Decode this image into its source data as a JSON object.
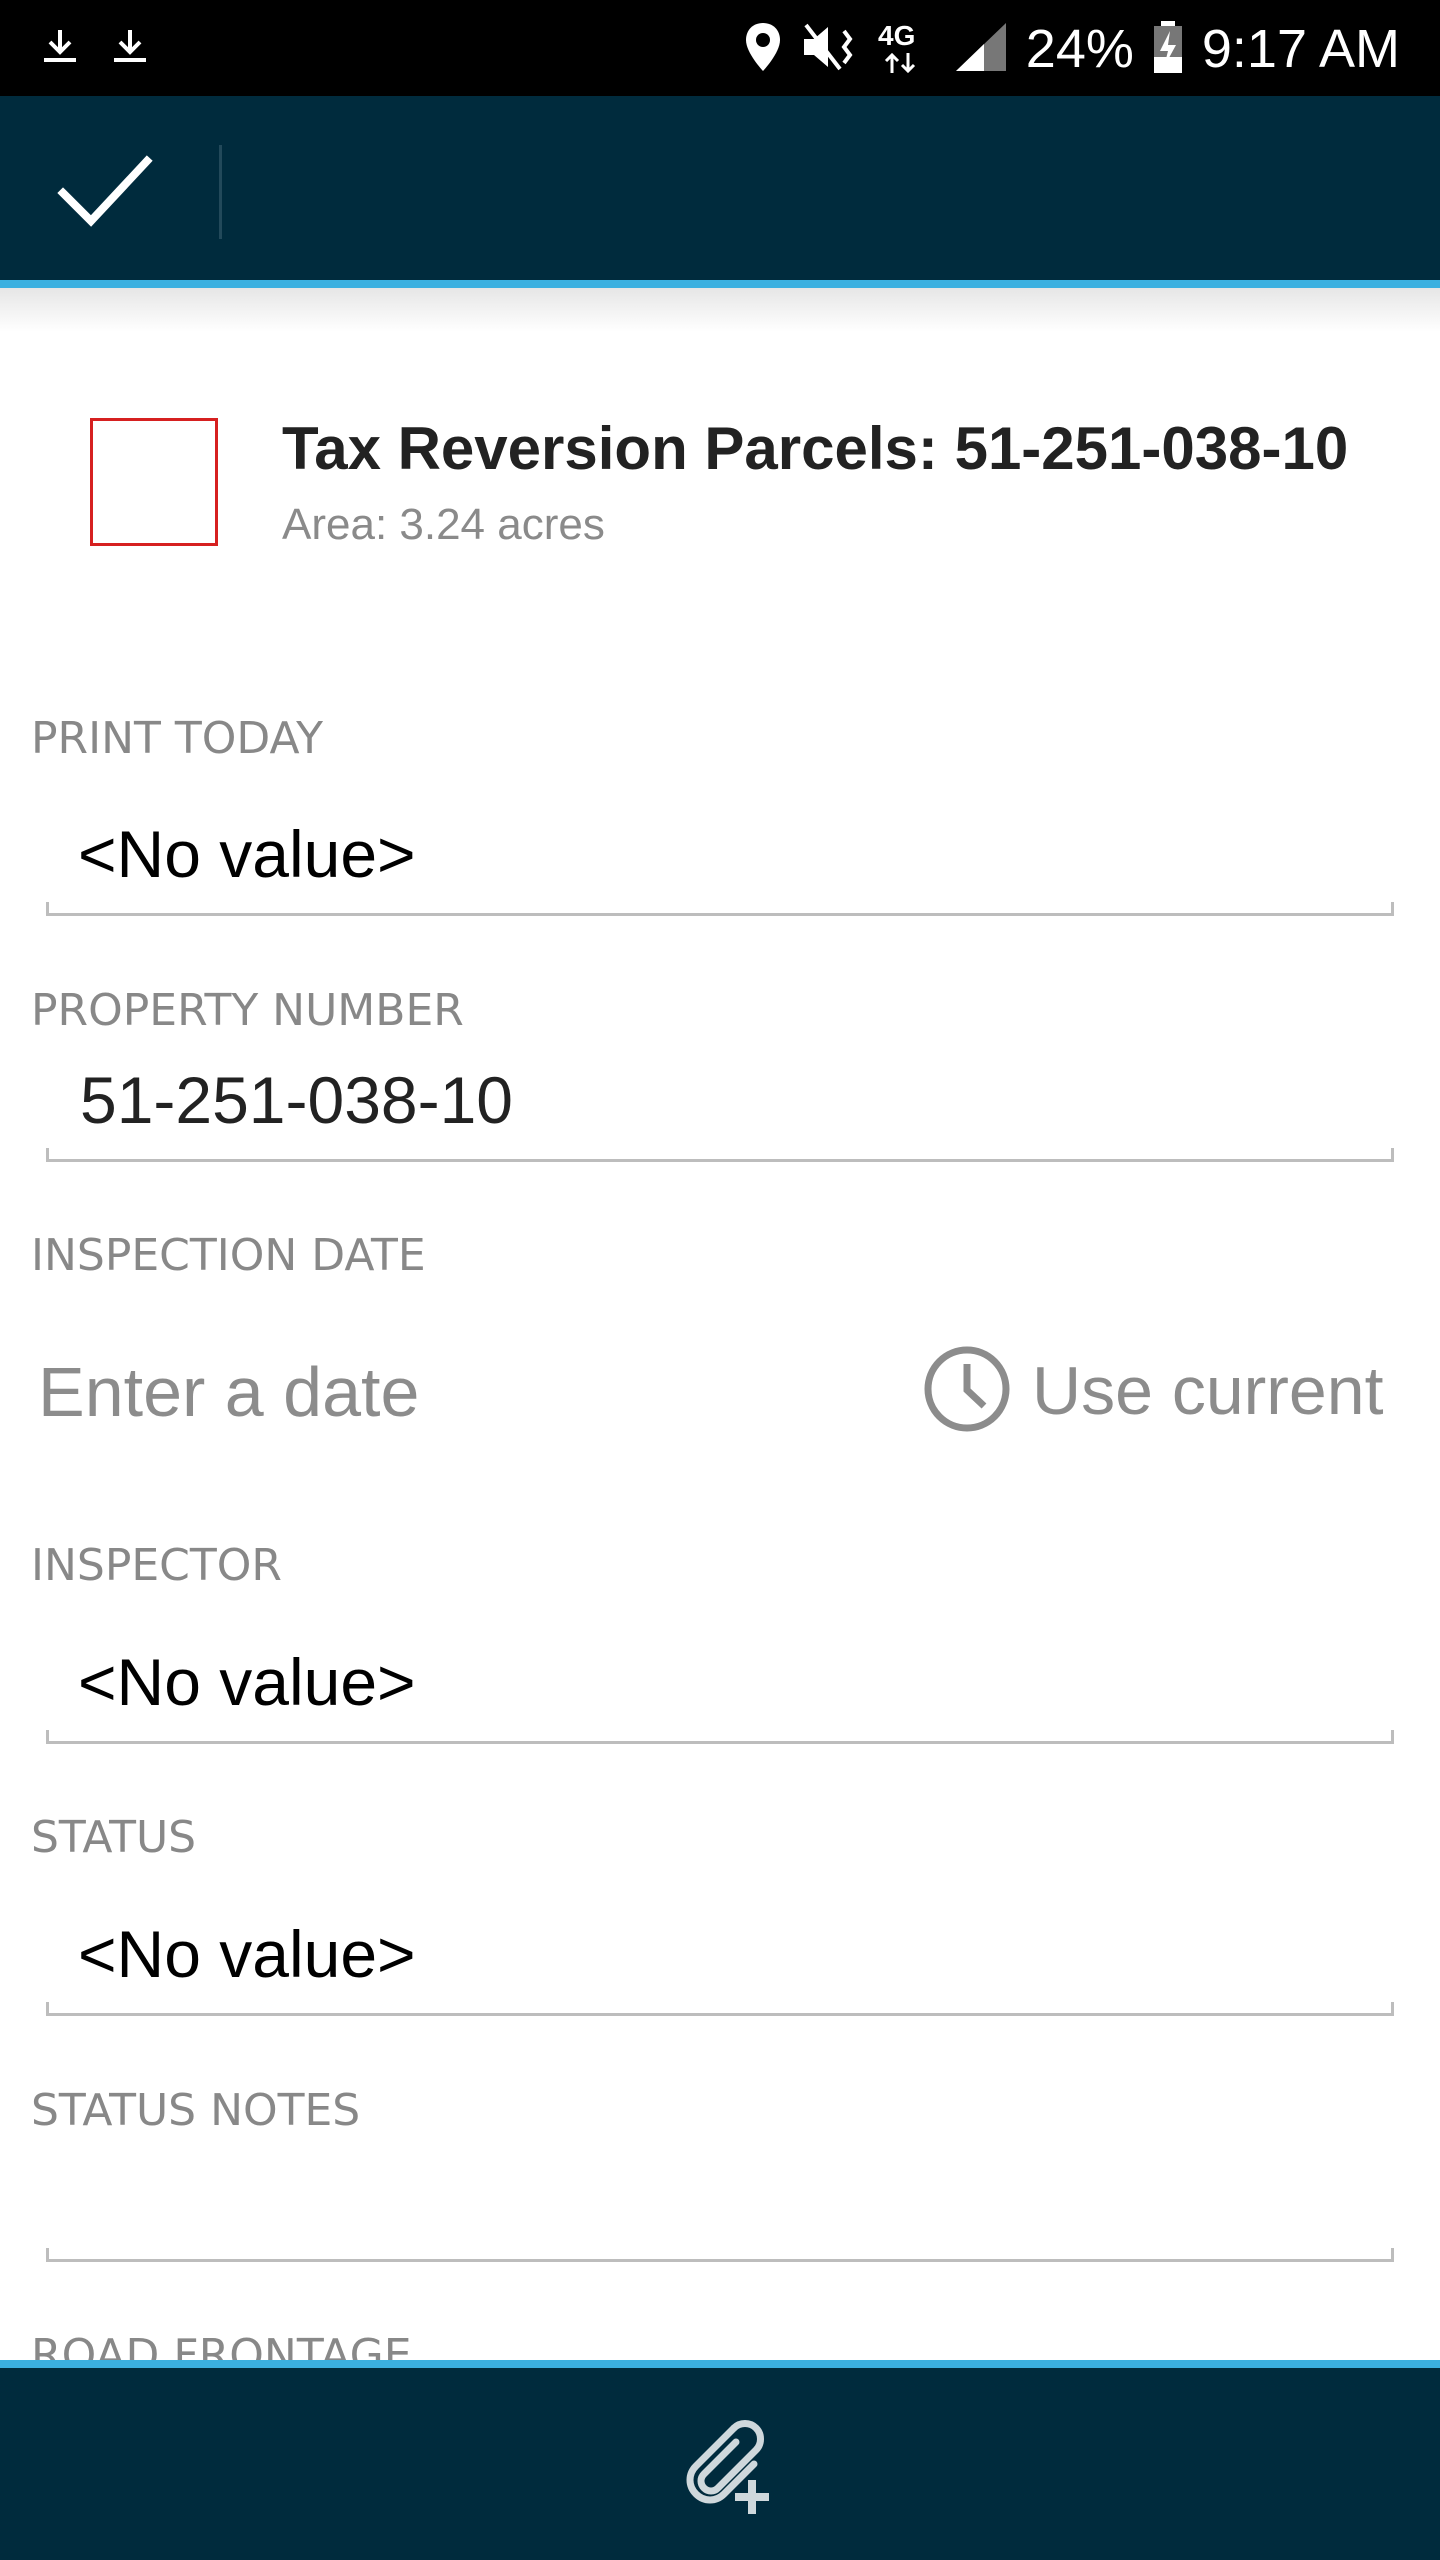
{
  "status_bar": {
    "left_icons": [
      "download-icon",
      "download-icon"
    ],
    "right_icons": [
      "location-icon",
      "mute-vibrate-icon",
      "lte-signal-icon",
      "cell-signal-icon"
    ],
    "network": "4G",
    "battery_percent": "24%",
    "time": "9:17 AM"
  },
  "app_bar": {
    "confirm_icon": "checkmark-icon",
    "background_color": "#002b3d",
    "accent_color": "#3bb0e0"
  },
  "feature": {
    "title": "Tax Reversion Parcels: 51-251-038-10",
    "subtitle": "Area: 3.24 acres",
    "swatch_color": "#d62020"
  },
  "fields": {
    "print_today": {
      "label": "PRINT TODAY",
      "value": "<No value>"
    },
    "property_number": {
      "label": "PROPERTY NUMBER",
      "value": "51-251-038-10"
    },
    "inspection_date": {
      "label": "INSPECTION DATE",
      "placeholder": "Enter a date",
      "use_current": "Use current",
      "icon": "clock-icon"
    },
    "inspector": {
      "label": "INSPECTOR",
      "value": "<No value>"
    },
    "status": {
      "label": "STATUS",
      "value": "<No value>"
    },
    "status_notes": {
      "label": "STATUS NOTES",
      "value": ""
    },
    "next": {
      "label": "ROAD FRONTAGE"
    }
  },
  "bottom_bar": {
    "attach_icon": "attachment-add-icon"
  }
}
